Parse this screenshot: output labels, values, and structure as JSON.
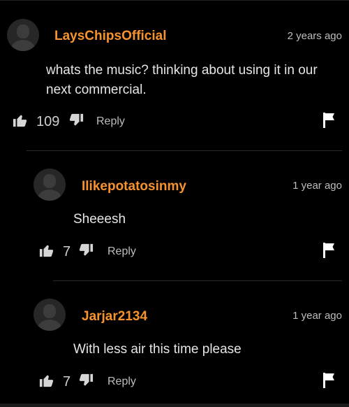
{
  "comments": [
    {
      "username": "LaysChipsOfficial",
      "time": "2 years ago",
      "text": "whats the music? thinking about using it in our next commercial.",
      "likes": "109",
      "reply_label": "Reply"
    },
    {
      "username": "Ilikepotatosinmy",
      "time": "1 year ago",
      "text": "Sheeesh",
      "likes": "7",
      "reply_label": "Reply"
    },
    {
      "username": "Jarjar2134",
      "time": "1 year ago",
      "text": "With less air this time please",
      "likes": "7",
      "reply_label": "Reply"
    }
  ],
  "colors": {
    "background": "#000000",
    "username": "#f7932f",
    "text": "#e6e6e6",
    "muted": "#bdbdbd"
  },
  "icons": [
    "avatar-placeholder",
    "thumbs-up-icon",
    "thumbs-down-icon",
    "flag-icon"
  ]
}
